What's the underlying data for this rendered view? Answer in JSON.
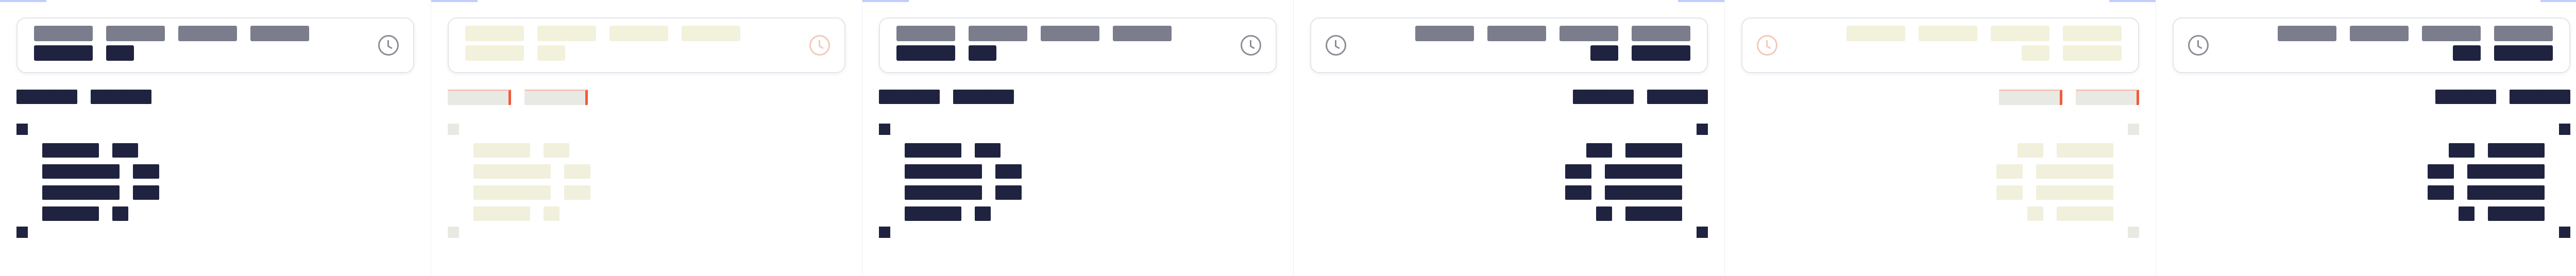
{
  "panels": [
    {
      "theme": "dark",
      "dir": "ltr",
      "header": {
        "line1": [
          "Sin título",
          "Sin título",
          "Sin título",
          "Sin título"
        ],
        "line2": [
          "Sin título",
          "Sin"
        ]
      },
      "tabs": [
        "Sin título",
        "Sin título"
      ],
      "list": [
        [
          "Sin título",
          "Sin"
        ],
        [
          "Sin título Sin",
          "Sin"
        ],
        [
          "Sin título Sin",
          "Sin"
        ],
        [
          "Sin título",
          "S"
        ]
      ]
    },
    {
      "theme": "ghost",
      "dir": "ltr",
      "header": {
        "line1": [
          "Sin título",
          "Sin título",
          "Sin título",
          "Sin título"
        ],
        "line2": [
          "Sin título",
          "Sin"
        ]
      },
      "tabs": [
        "Sin título",
        "Sin título"
      ],
      "list": [
        [
          "Sin título",
          "Sin"
        ],
        [
          "Sin título Sin",
          "Sin"
        ],
        [
          "Sin título Sin",
          "Sin"
        ],
        [
          "Sin título",
          "S"
        ]
      ]
    },
    {
      "theme": "dark",
      "dir": "ltr",
      "header": {
        "line1": [
          "Sin título",
          "Sin título",
          "Sin título",
          "Sin título"
        ],
        "line2": [
          "Sin título",
          "Sin"
        ]
      },
      "tabs": [
        "Sin título",
        "Sin título"
      ],
      "list": [
        [
          "Sin título",
          "Sin"
        ],
        [
          "Sin título Sin",
          "Sin"
        ],
        [
          "Sin título Sin",
          "Sin"
        ],
        [
          "Sin título",
          "S"
        ]
      ]
    },
    {
      "theme": "dark",
      "dir": "rtl",
      "header": {
        "line1": [
          "Sin título",
          "Sin título",
          "Sin título",
          "Sin título"
        ],
        "line2": [
          "Sin título",
          "Sin"
        ]
      },
      "tabs": [
        "Sin título",
        "Sin título"
      ],
      "list": [
        [
          "Sin título",
          "Sin"
        ],
        [
          "Sin título Sin",
          "Sin"
        ],
        [
          "Sin título Sin",
          "Sin"
        ],
        [
          "Sin título",
          "S"
        ]
      ]
    },
    {
      "theme": "ghost",
      "dir": "rtl",
      "header": {
        "line1": [
          "Sin título",
          "Sin título",
          "Sin título",
          "Sin título"
        ],
        "line2": [
          "Sin título",
          "Sin"
        ]
      },
      "tabs": [
        "Sin título",
        "Sin título"
      ],
      "list": [
        [
          "Sin título",
          "Sin"
        ],
        [
          "Sin título Sin",
          "Sin"
        ],
        [
          "Sin título Sin",
          "Sin"
        ],
        [
          "Sin título",
          "S"
        ]
      ]
    },
    {
      "theme": "dark",
      "dir": "rtl",
      "header": {
        "line1": [
          "Sin título",
          "Sin título",
          "Sin título",
          "Sin título"
        ],
        "line2": [
          "Sin título",
          "Sin"
        ]
      },
      "tabs": [
        "Sin título",
        "Sin título"
      ],
      "list": [
        [
          "Sin título",
          "Sin"
        ],
        [
          "Sin título Sin",
          "Sin"
        ],
        [
          "Sin título Sin",
          "Sin"
        ],
        [
          "Sin título",
          "S"
        ]
      ]
    }
  ],
  "icons": {
    "clock": "clock-icon",
    "marker": "square-marker"
  },
  "colors": {
    "navy": "#1f2340",
    "grey": "#7b7d8c",
    "ghost": "#f2f2dc",
    "accent": "#f25a3a"
  }
}
